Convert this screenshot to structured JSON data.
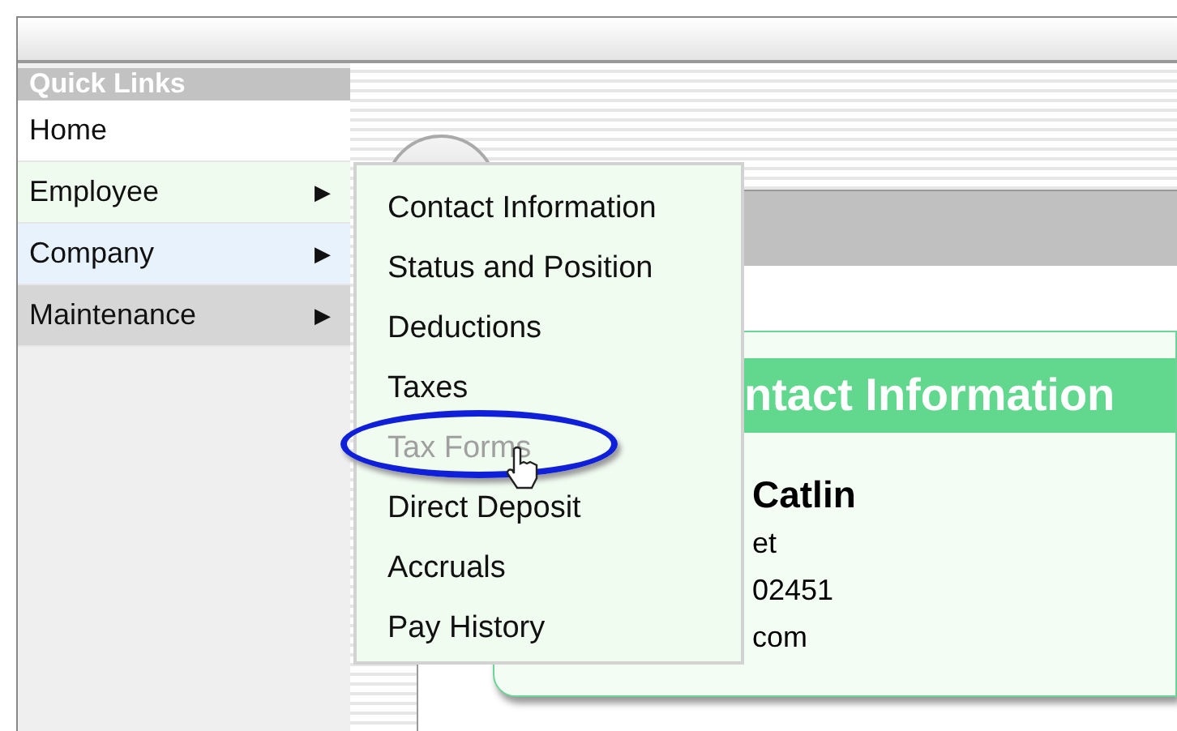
{
  "sidebar": {
    "title": "Quick Links",
    "items": [
      {
        "label": "Home",
        "has_submenu": false,
        "color": "#ffffff"
      },
      {
        "label": "Employee",
        "has_submenu": true,
        "color": "#f0fbf0"
      },
      {
        "label": "Company",
        "has_submenu": true,
        "color": "#e8f2fc"
      },
      {
        "label": "Maintenance",
        "has_submenu": true,
        "color": "#d6d6d6"
      }
    ]
  },
  "arrow": "▶",
  "submenu": {
    "items": [
      {
        "label": "Contact Information",
        "highlighted": false
      },
      {
        "label": "Status and Position",
        "highlighted": false
      },
      {
        "label": "Deductions",
        "highlighted": false
      },
      {
        "label": "Taxes",
        "highlighted": false
      },
      {
        "label": "Tax Forms",
        "highlighted": true
      },
      {
        "label": "Direct Deposit",
        "highlighted": false
      },
      {
        "label": "Accruals",
        "highlighted": false
      },
      {
        "label": "Pay History",
        "highlighted": false
      }
    ]
  },
  "card": {
    "title": "ntact Information",
    "name": "Catlin",
    "lines": [
      "et",
      "02451",
      "com"
    ]
  }
}
